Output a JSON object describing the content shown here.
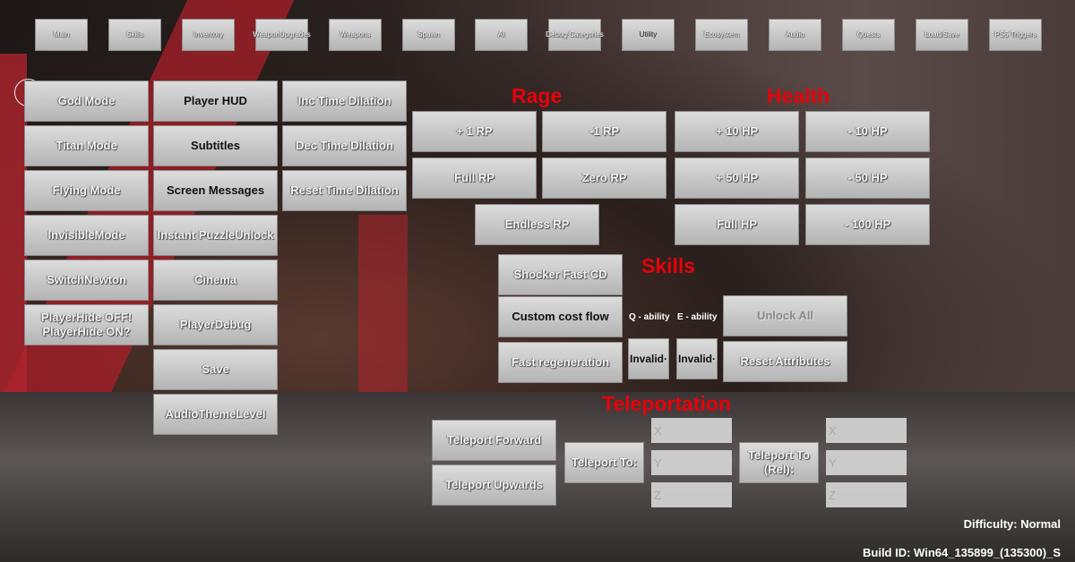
{
  "tabs": [
    {
      "label": "Main"
    },
    {
      "label": "Skills"
    },
    {
      "label": "Inventory"
    },
    {
      "label": "WeaponUpgrades"
    },
    {
      "label": "Weapons"
    },
    {
      "label": "Spawn"
    },
    {
      "label": "AI"
    },
    {
      "label": "Debug Categories"
    },
    {
      "label": "Utility",
      "selected": true
    },
    {
      "label": "Ecosystem"
    },
    {
      "label": "Audio"
    },
    {
      "label": "Quests"
    },
    {
      "label": "Load/Save"
    },
    {
      "label": "PS5 Triggers"
    }
  ],
  "col1": [
    "God Mode",
    "Titan Mode",
    "Flying Mode",
    "InvisibleMode",
    "SwitchNewton",
    "PlayerHide OFF!\nPlayerHide ON?"
  ],
  "col2": [
    "Player HUD",
    "Subtitles",
    "Screen Messages",
    "Instant PuzzleUnlock",
    "Cinema",
    "PlayerDebug",
    "Save",
    "AudioThemeLevel"
  ],
  "col3": [
    "Inc Time Dilation",
    "Dec Time Dilation",
    "Reset Time Dilation"
  ],
  "rage": {
    "title": "Rage",
    "buttons": [
      "+ 1 RP",
      "-1 RP",
      "Full RP",
      "Zero RP",
      "Endless RP"
    ]
  },
  "health": {
    "title": "Health",
    "buttons": [
      "+ 10 HP",
      "- 10 HP",
      "+ 50 HP",
      "- 50 HP",
      "Full HP",
      "- 100 HP"
    ]
  },
  "skills": {
    "title": "Skills",
    "shocker": "Shocker Fast CD",
    "custom_cost": "Custom cost flow",
    "fast_regen": "Fast regeneration",
    "q_label": "Q - ability",
    "e_label": "E - ability",
    "q_value": "Invalid·",
    "e_value": "Invalid·",
    "unlock_all": "Unlock All",
    "reset_attributes": "Reset Attributes"
  },
  "teleport": {
    "title": "Teleportation",
    "forward": "Teleport Forward",
    "upwards": "Teleport Upwards",
    "to": "Teleport To:",
    "to_rel": "Teleport To\n(Rel):",
    "x_placeholder": "X",
    "y_placeholder": "Y",
    "z_placeholder": "Z"
  },
  "difficulty": "Difficulty: Normal",
  "build_id": "Build ID: Win64_135899_(135300)_S",
  "colors": {
    "section_title": "#e8000a",
    "button": "#c8c8c8"
  }
}
